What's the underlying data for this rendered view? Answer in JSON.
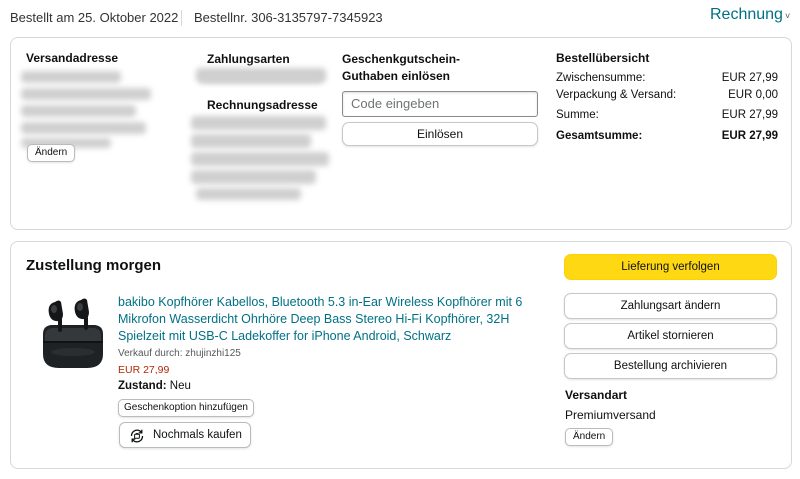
{
  "header": {
    "order_date": "Bestellt am 25. Oktober 2022",
    "order_number": "Bestellnr. 306-3135797-7345923",
    "invoice_label": "Rechnung",
    "invoice_chevron": "˅"
  },
  "shipping_address": {
    "heading": "Versandadresse",
    "change_label": "Ändern"
  },
  "payment": {
    "methods_heading": "Zahlungsarten",
    "billing_heading": "Rechnungsadresse"
  },
  "giftcard": {
    "heading": "Geschenkgutschein-Guthaben einlösen",
    "input_placeholder": "Code eingeben",
    "redeem_label": "Einlösen"
  },
  "summary": {
    "heading": "Bestellübersicht",
    "rows": [
      {
        "label": "Zwischensumme:",
        "value": "EUR 27,99"
      },
      {
        "label": "Verpackung & Versand:",
        "value": "EUR 0,00"
      },
      {
        "label": "Summe:",
        "value": "EUR 27,99"
      },
      {
        "label": "Gesamtsumme:",
        "value": "EUR 27,99"
      }
    ]
  },
  "delivery": {
    "title": "Zustellung morgen",
    "product_title": "bakibo Kopfhörer Kabellos, Bluetooth 5.3 in-Ear Wireless Kopfhörer mit 6 Mikrofon Wasserdicht Ohrhöre Deep Bass Stereo Hi-Fi Kopfhörer, 32H Spielzeit mit USB-C Ladekoffer for iPhone Android, Schwarz",
    "seller": "Verkauf durch: zhujinzhi125",
    "price": "EUR 27,99",
    "condition_label": "Zustand:",
    "condition_value": "Neu",
    "gift_option_label": "Geschenkoption hinzufügen",
    "buy_again_label": "Nochmals kaufen",
    "buy_again_icon": "rebuy-icon",
    "product_image_icon": "earbuds-product-image"
  },
  "actions": {
    "track_label": "Lieferung verfolgen",
    "change_payment_label": "Zahlungsart ändern",
    "cancel_items_label": "Artikel stornieren",
    "archive_label": "Bestellung archivieren"
  },
  "shipping_method": {
    "heading": "Versandart",
    "value": "Premiumversand",
    "change_label": "Ändern"
  },
  "colors": {
    "link": "#007185",
    "price": "#B12704",
    "primary_button": "#FFD814",
    "border": "#D5D9D9"
  }
}
